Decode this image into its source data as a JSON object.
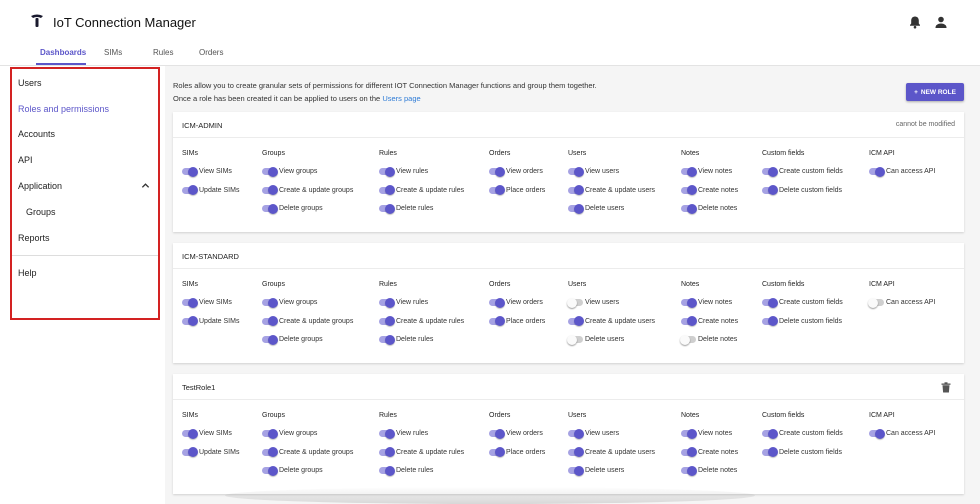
{
  "app": {
    "title": "IoT Connection Manager"
  },
  "top_nav": {
    "tabs": [
      {
        "label": "Dashboards",
        "active": true
      },
      {
        "label": "SIMs",
        "active": false
      },
      {
        "label": "Rules",
        "active": false
      },
      {
        "label": "Orders",
        "active": false
      }
    ]
  },
  "header_icons": [
    "bell-icon",
    "person-icon"
  ],
  "sidebar": {
    "items": [
      {
        "label": "Users"
      },
      {
        "label": "Roles and permissions",
        "active": true
      },
      {
        "label": "Accounts"
      },
      {
        "label": "API"
      },
      {
        "label": "Application",
        "expanded": true
      },
      {
        "label": "Groups"
      },
      {
        "label": "Reports"
      },
      {
        "label": "Help"
      }
    ]
  },
  "main": {
    "intro_line1": "Roles allow you to create granular sets of permissions for different IOT Connection Manager functions and group them together.",
    "intro_line2": "Once a role has been created it can be applied to users on the",
    "intro_link": "Users page",
    "new_role_label": "NEW ROLE",
    "colors": {
      "accent": "#5c56c9",
      "toggle_track_on": "#a6a2e3",
      "toggle_off": "#cfcfcf"
    },
    "roles": [
      {
        "name": "ICM-ADMIN",
        "note": "cannot be modified",
        "columns": [
          {
            "header": "SIMs",
            "perms": [
              {
                "label": "View SIMs",
                "on": true
              },
              {
                "label": "Update SIMs",
                "on": true
              }
            ]
          },
          {
            "header": "Groups",
            "perms": [
              {
                "label": "View groups",
                "on": true
              },
              {
                "label": "Create & update groups",
                "on": true
              },
              {
                "label": "Delete groups",
                "on": true
              }
            ]
          },
          {
            "header": "Rules",
            "perms": [
              {
                "label": "View rules",
                "on": true
              },
              {
                "label": "Create & update rules",
                "on": true
              },
              {
                "label": "Delete rules",
                "on": true
              }
            ]
          },
          {
            "header": "Orders",
            "perms": [
              {
                "label": "View orders",
                "on": true
              },
              {
                "label": "Place orders",
                "on": true
              }
            ]
          },
          {
            "header": "Users",
            "perms": [
              {
                "label": "View users",
                "on": true
              },
              {
                "label": "Create & update users",
                "on": true
              },
              {
                "label": "Delete users",
                "on": true
              }
            ]
          },
          {
            "header": "Notes",
            "perms": [
              {
                "label": "View notes",
                "on": true
              },
              {
                "label": "Create notes",
                "on": true
              },
              {
                "label": "Delete notes",
                "on": true
              }
            ]
          },
          {
            "header": "Custom fields",
            "perms": [
              {
                "label": "Create custom fields",
                "on": true
              },
              {
                "label": "Delete custom fields",
                "on": true
              }
            ]
          },
          {
            "header": "ICM API",
            "perms": [
              {
                "label": "Can access API",
                "on": true
              }
            ]
          }
        ]
      },
      {
        "name": "ICM-STANDARD",
        "note": "",
        "columns": [
          {
            "header": "SIMs",
            "perms": [
              {
                "label": "View SIMs",
                "on": true
              },
              {
                "label": "Update SIMs",
                "on": true
              }
            ]
          },
          {
            "header": "Groups",
            "perms": [
              {
                "label": "View groups",
                "on": true
              },
              {
                "label": "Create & update groups",
                "on": true
              },
              {
                "label": "Delete groups",
                "on": true
              }
            ]
          },
          {
            "header": "Rules",
            "perms": [
              {
                "label": "View rules",
                "on": true
              },
              {
                "label": "Create & update rules",
                "on": true
              },
              {
                "label": "Delete rules",
                "on": true
              }
            ]
          },
          {
            "header": "Orders",
            "perms": [
              {
                "label": "View orders",
                "on": true
              },
              {
                "label": "Place orders",
                "on": true
              }
            ]
          },
          {
            "header": "Users",
            "perms": [
              {
                "label": "View users",
                "on": false
              },
              {
                "label": "Create & update users",
                "on": true
              },
              {
                "label": "Delete users",
                "on": false
              }
            ]
          },
          {
            "header": "Notes",
            "perms": [
              {
                "label": "View notes",
                "on": true
              },
              {
                "label": "Create notes",
                "on": true
              },
              {
                "label": "Delete notes",
                "on": false
              }
            ]
          },
          {
            "header": "Custom fields",
            "perms": [
              {
                "label": "Create custom fields",
                "on": true
              },
              {
                "label": "Delete custom fields",
                "on": true
              }
            ]
          },
          {
            "header": "ICM API",
            "perms": [
              {
                "label": "Can access API",
                "on": false
              }
            ]
          }
        ]
      },
      {
        "name": "TestRole1",
        "note": "",
        "deletable": true,
        "columns": [
          {
            "header": "SIMs",
            "perms": [
              {
                "label": "View SIMs",
                "on": true
              },
              {
                "label": "Update SIMs",
                "on": true
              }
            ]
          },
          {
            "header": "Groups",
            "perms": [
              {
                "label": "View groups",
                "on": true
              },
              {
                "label": "Create & update groups",
                "on": true
              },
              {
                "label": "Delete groups",
                "on": true
              }
            ]
          },
          {
            "header": "Rules",
            "perms": [
              {
                "label": "View rules",
                "on": true
              },
              {
                "label": "Create & update rules",
                "on": true
              },
              {
                "label": "Delete rules",
                "on": true
              }
            ]
          },
          {
            "header": "Orders",
            "perms": [
              {
                "label": "View orders",
                "on": true
              },
              {
                "label": "Place orders",
                "on": true
              }
            ]
          },
          {
            "header": "Users",
            "perms": [
              {
                "label": "View users",
                "on": true
              },
              {
                "label": "Create & update users",
                "on": true
              },
              {
                "label": "Delete users",
                "on": true
              }
            ]
          },
          {
            "header": "Notes",
            "perms": [
              {
                "label": "View notes",
                "on": true
              },
              {
                "label": "Create notes",
                "on": true
              },
              {
                "label": "Delete notes",
                "on": true
              }
            ]
          },
          {
            "header": "Custom fields",
            "perms": [
              {
                "label": "Create custom fields",
                "on": true
              },
              {
                "label": "Delete custom fields",
                "on": true
              }
            ]
          },
          {
            "header": "ICM API",
            "perms": [
              {
                "label": "Can access API",
                "on": true
              }
            ]
          }
        ]
      }
    ]
  }
}
